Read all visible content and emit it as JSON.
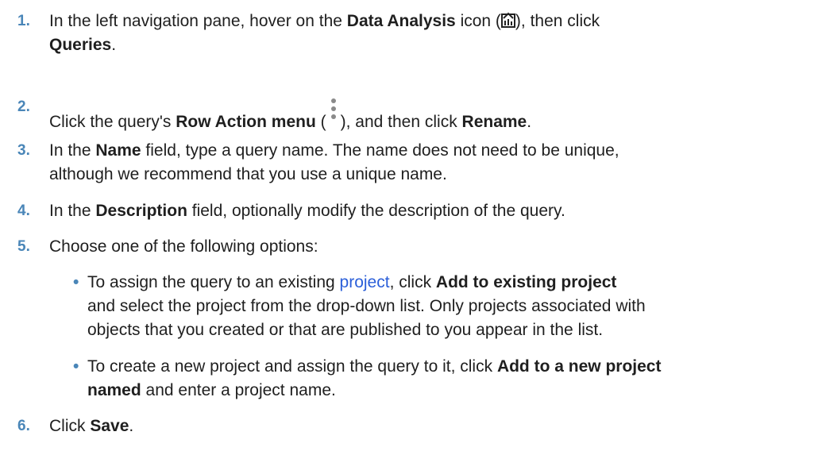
{
  "steps": [
    {
      "number": "1.",
      "line1_pre": "In the left navigation pane, hover on the ",
      "line1_bold": "Data Analysis",
      "line1_mid": " icon (",
      "line1_post": "), then click",
      "line2_bold": "Queries",
      "line2_post": ".",
      "icon": "data-analysis-icon"
    },
    {
      "number": "2.",
      "pre": "Click the query's ",
      "bold1": "Row Action menu",
      "mid1": " (",
      "mid2": "), and then click ",
      "bold2": "Rename",
      "post": ".",
      "icon": "kebab-menu-icon"
    },
    {
      "number": "3.",
      "line1_pre": "In the ",
      "line1_bold": "Name",
      "line1_post": " field, type a query name. The name does not need to be unique,",
      "line2": "although we recommend that you use a unique name."
    },
    {
      "number": "4.",
      "pre": "In the ",
      "bold": "Description",
      "post": " field, optionally modify the description of the query."
    },
    {
      "number": "5.",
      "text": "Choose one of the following options:",
      "bullets": [
        {
          "line1_pre": "To assign the query to an existing ",
          "line1_link": "project",
          "line1_mid": ", click ",
          "line1_bold": "Add to existing project",
          "line2": "and select the project from the drop-down list. Only projects associated with",
          "line3": "objects that you created or that are published to you appear in the list."
        },
        {
          "line1_pre": "To create a new project and assign the query to it, click ",
          "line1_bold": "Add to a new project",
          "line2_bold": "named",
          "line2_post": " and enter a project name."
        }
      ]
    },
    {
      "number": "6.",
      "pre": "Click ",
      "bold": "Save",
      "post": "."
    }
  ],
  "bullet_glyph": "•",
  "colors": {
    "number": "#4a86b8",
    "text": "#1f1f1f",
    "link": "#2b5fd9"
  }
}
